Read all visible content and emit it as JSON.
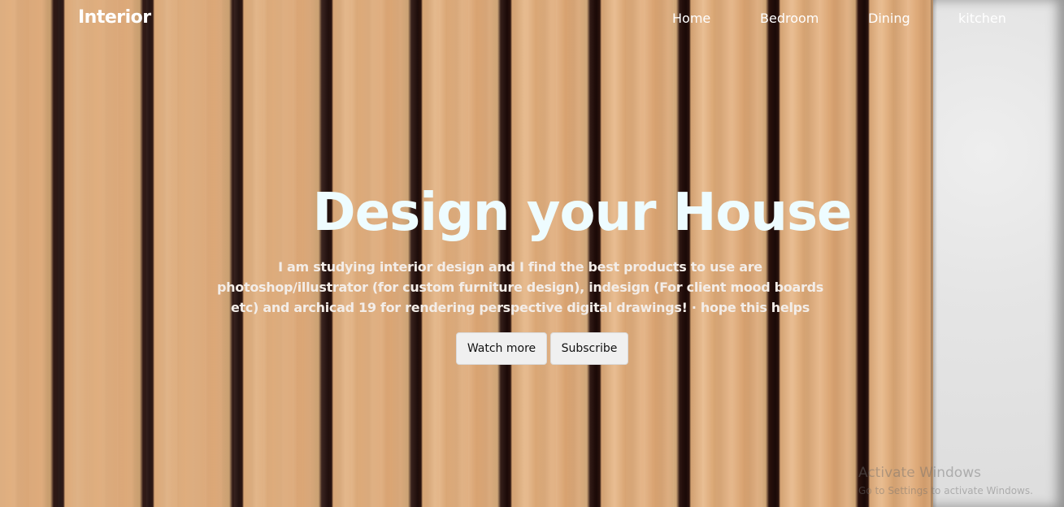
{
  "brand": {
    "logo": "Interior"
  },
  "nav": {
    "links": [
      "Home",
      "Bedroom",
      "Dining",
      "kitchen"
    ]
  },
  "hero": {
    "title": "Design your House",
    "description": "I am studying interior design and I find the best products to use are photoshop/illustrator (for custom furniture design), indesign (For client mood boards etc) and archicad 19 for rendering perspective digital drawings! · hope this helps",
    "buttons": {
      "primary": "Watch more",
      "secondary": "Subscribe"
    }
  },
  "watermark": {
    "title": "Activate Windows",
    "subtitle": "Go to Settings to activate Windows."
  },
  "colors": {
    "title": "#eefcff",
    "button_bg": "#f0f0f0",
    "wood": "#d9a777",
    "gap": "#1a0907",
    "wall": "#e5e5e5"
  }
}
